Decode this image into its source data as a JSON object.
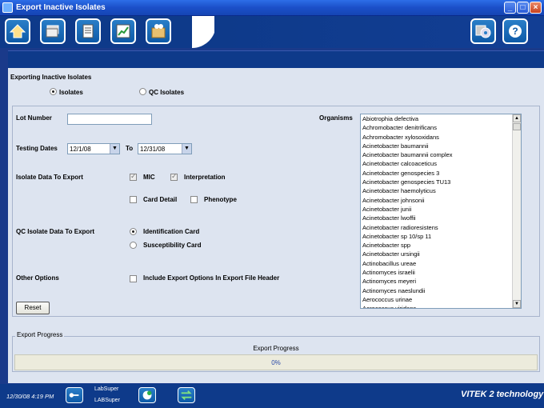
{
  "window": {
    "title": "Export Inactive Isolates"
  },
  "panel": {
    "heading": "Exporting Inactive Isolates"
  },
  "type_radios": {
    "isolates": "Isolates",
    "qc": "QC Isolates"
  },
  "form": {
    "lot_number_label": "Lot Number",
    "lot_number_value": "",
    "testing_dates_label": "Testing Dates",
    "from_date": "12/1/08",
    "to_label": "To",
    "to_date": "12/31/08",
    "isolate_data_label": "Isolate Data To Export",
    "mic": "MIC",
    "interpretation": "Interpretation",
    "card_detail": "Card Detail",
    "phenotype": "Phenotype",
    "qc_data_label": "QC Isolate Data To Export",
    "identification_card": "Identification Card",
    "susceptibility_card": "Susceptibility Card",
    "other_options_label": "Other Options",
    "include_export_options": "Include Export Options In Export File Header",
    "reset_label": "Reset"
  },
  "organisms": {
    "label": "Organisms",
    "items": [
      "Abiotrophia defectiva",
      "Achromobacter denitrificans",
      "Achromobacter xylosoxidans",
      "Acinetobacter baumannii",
      "Acinetobacter baumannii complex",
      "Acinetobacter calcoaceticus",
      "Acinetobacter genospecies 3",
      "Acinetobacter genospecies TU13",
      "Acinetobacter haemolyticus",
      "Acinetobacter johnsonii",
      "Acinetobacter junii",
      "Acinetobacter lwoffii",
      "Acinetobacter radioresistens",
      "Acinetobacter sp 10/sp 11",
      "Acinetobacter spp",
      "Acinetobacter ursingii",
      "Actinobacillus ureae",
      "Actinomyces israelii",
      "Actinomyces meyeri",
      "Actinomyces naeslundii",
      "Aerococcus urinae",
      "Aerococcus viridans"
    ]
  },
  "progress": {
    "group_label": "Export Progress",
    "label": "Export Progress",
    "value_text": "0%",
    "fraction": 0
  },
  "status": {
    "datetime": "12/30/08 4:19 PM",
    "user1": "LabSuper",
    "user2": "LABSuper",
    "brand": "VITEK 2 technology"
  },
  "colors": {
    "toolbar_bg": "#0e3a8a",
    "panel_bg": "#dde4f0",
    "titlebar": "#1b4fc8"
  }
}
